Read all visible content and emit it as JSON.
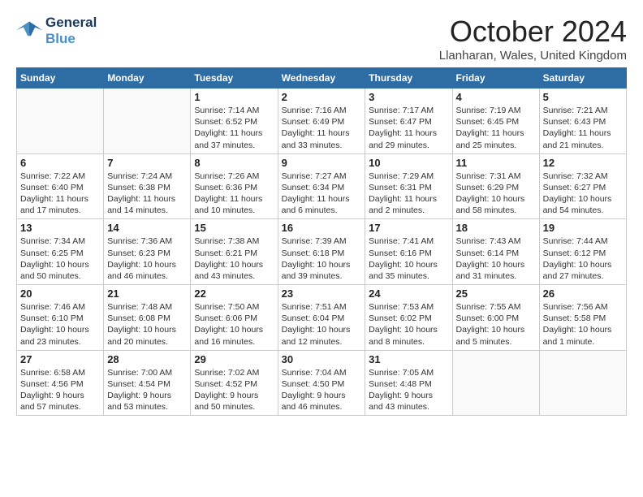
{
  "header": {
    "logo_line1": "General",
    "logo_line2": "Blue",
    "title": "October 2024",
    "location": "Llanharan, Wales, United Kingdom"
  },
  "weekdays": [
    "Sunday",
    "Monday",
    "Tuesday",
    "Wednesday",
    "Thursday",
    "Friday",
    "Saturday"
  ],
  "weeks": [
    [
      {
        "day": "",
        "detail": ""
      },
      {
        "day": "",
        "detail": ""
      },
      {
        "day": "1",
        "detail": "Sunrise: 7:14 AM\nSunset: 6:52 PM\nDaylight: 11 hours\nand 37 minutes."
      },
      {
        "day": "2",
        "detail": "Sunrise: 7:16 AM\nSunset: 6:49 PM\nDaylight: 11 hours\nand 33 minutes."
      },
      {
        "day": "3",
        "detail": "Sunrise: 7:17 AM\nSunset: 6:47 PM\nDaylight: 11 hours\nand 29 minutes."
      },
      {
        "day": "4",
        "detail": "Sunrise: 7:19 AM\nSunset: 6:45 PM\nDaylight: 11 hours\nand 25 minutes."
      },
      {
        "day": "5",
        "detail": "Sunrise: 7:21 AM\nSunset: 6:43 PM\nDaylight: 11 hours\nand 21 minutes."
      }
    ],
    [
      {
        "day": "6",
        "detail": "Sunrise: 7:22 AM\nSunset: 6:40 PM\nDaylight: 11 hours\nand 17 minutes."
      },
      {
        "day": "7",
        "detail": "Sunrise: 7:24 AM\nSunset: 6:38 PM\nDaylight: 11 hours\nand 14 minutes."
      },
      {
        "day": "8",
        "detail": "Sunrise: 7:26 AM\nSunset: 6:36 PM\nDaylight: 11 hours\nand 10 minutes."
      },
      {
        "day": "9",
        "detail": "Sunrise: 7:27 AM\nSunset: 6:34 PM\nDaylight: 11 hours\nand 6 minutes."
      },
      {
        "day": "10",
        "detail": "Sunrise: 7:29 AM\nSunset: 6:31 PM\nDaylight: 11 hours\nand 2 minutes."
      },
      {
        "day": "11",
        "detail": "Sunrise: 7:31 AM\nSunset: 6:29 PM\nDaylight: 10 hours\nand 58 minutes."
      },
      {
        "day": "12",
        "detail": "Sunrise: 7:32 AM\nSunset: 6:27 PM\nDaylight: 10 hours\nand 54 minutes."
      }
    ],
    [
      {
        "day": "13",
        "detail": "Sunrise: 7:34 AM\nSunset: 6:25 PM\nDaylight: 10 hours\nand 50 minutes."
      },
      {
        "day": "14",
        "detail": "Sunrise: 7:36 AM\nSunset: 6:23 PM\nDaylight: 10 hours\nand 46 minutes."
      },
      {
        "day": "15",
        "detail": "Sunrise: 7:38 AM\nSunset: 6:21 PM\nDaylight: 10 hours\nand 43 minutes."
      },
      {
        "day": "16",
        "detail": "Sunrise: 7:39 AM\nSunset: 6:18 PM\nDaylight: 10 hours\nand 39 minutes."
      },
      {
        "day": "17",
        "detail": "Sunrise: 7:41 AM\nSunset: 6:16 PM\nDaylight: 10 hours\nand 35 minutes."
      },
      {
        "day": "18",
        "detail": "Sunrise: 7:43 AM\nSunset: 6:14 PM\nDaylight: 10 hours\nand 31 minutes."
      },
      {
        "day": "19",
        "detail": "Sunrise: 7:44 AM\nSunset: 6:12 PM\nDaylight: 10 hours\nand 27 minutes."
      }
    ],
    [
      {
        "day": "20",
        "detail": "Sunrise: 7:46 AM\nSunset: 6:10 PM\nDaylight: 10 hours\nand 23 minutes."
      },
      {
        "day": "21",
        "detail": "Sunrise: 7:48 AM\nSunset: 6:08 PM\nDaylight: 10 hours\nand 20 minutes."
      },
      {
        "day": "22",
        "detail": "Sunrise: 7:50 AM\nSunset: 6:06 PM\nDaylight: 10 hours\nand 16 minutes."
      },
      {
        "day": "23",
        "detail": "Sunrise: 7:51 AM\nSunset: 6:04 PM\nDaylight: 10 hours\nand 12 minutes."
      },
      {
        "day": "24",
        "detail": "Sunrise: 7:53 AM\nSunset: 6:02 PM\nDaylight: 10 hours\nand 8 minutes."
      },
      {
        "day": "25",
        "detail": "Sunrise: 7:55 AM\nSunset: 6:00 PM\nDaylight: 10 hours\nand 5 minutes."
      },
      {
        "day": "26",
        "detail": "Sunrise: 7:56 AM\nSunset: 5:58 PM\nDaylight: 10 hours\nand 1 minute."
      }
    ],
    [
      {
        "day": "27",
        "detail": "Sunrise: 6:58 AM\nSunset: 4:56 PM\nDaylight: 9 hours\nand 57 minutes."
      },
      {
        "day": "28",
        "detail": "Sunrise: 7:00 AM\nSunset: 4:54 PM\nDaylight: 9 hours\nand 53 minutes."
      },
      {
        "day": "29",
        "detail": "Sunrise: 7:02 AM\nSunset: 4:52 PM\nDaylight: 9 hours\nand 50 minutes."
      },
      {
        "day": "30",
        "detail": "Sunrise: 7:04 AM\nSunset: 4:50 PM\nDaylight: 9 hours\nand 46 minutes."
      },
      {
        "day": "31",
        "detail": "Sunrise: 7:05 AM\nSunset: 4:48 PM\nDaylight: 9 hours\nand 43 minutes."
      },
      {
        "day": "",
        "detail": ""
      },
      {
        "day": "",
        "detail": ""
      }
    ]
  ]
}
